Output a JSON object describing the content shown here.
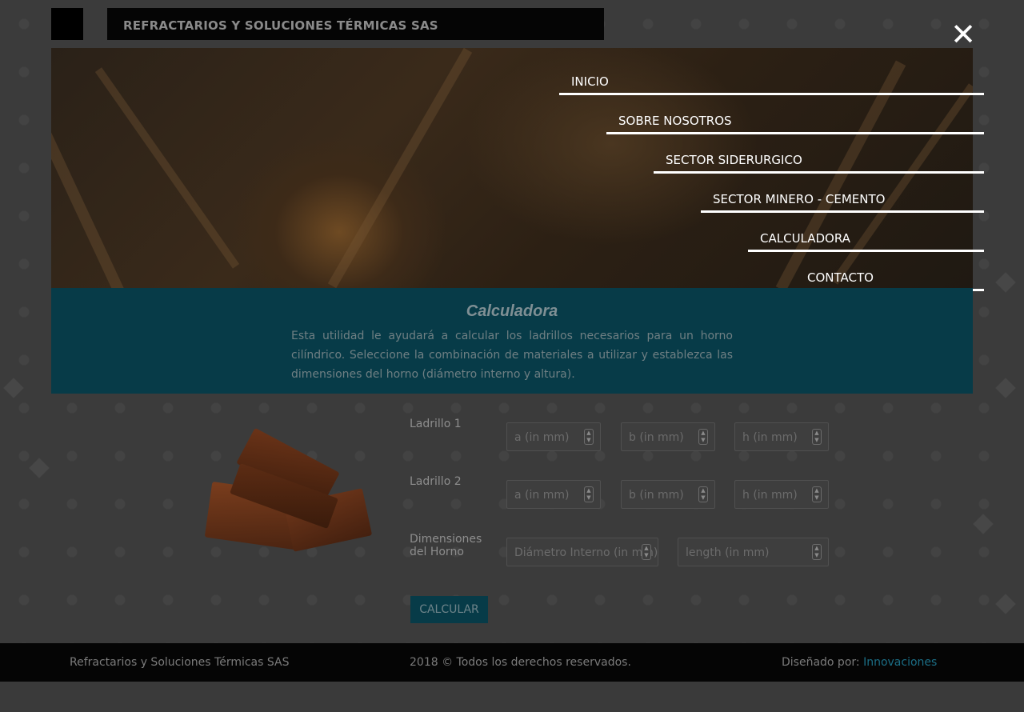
{
  "header": {
    "title": "REFRACTARIOS Y SOLUCIONES TÉRMICAS SAS",
    "close_icon": "close-icon"
  },
  "menu": {
    "items": [
      {
        "label": "INICIO"
      },
      {
        "label": "SOBRE NOSOTROS"
      },
      {
        "label": "SECTOR SIDERURGICO"
      },
      {
        "label": "SECTOR MINERO - CEMENTO"
      },
      {
        "label": "CALCULADORA"
      },
      {
        "label": "CONTACTO"
      }
    ]
  },
  "calculator": {
    "title": "Calculadora",
    "description": "Esta utilidad le ayudará a calcular los ladrillos necesarios para un horno cilíndrico. Seleccione la combinación de materiales a utilizar y establezca las dimensiones del horno (diámetro interno y altura).",
    "rows": [
      {
        "label": "Ladrillo 1",
        "placeholders": [
          "a (in mm)",
          "b (in mm)",
          "h (in mm)"
        ]
      },
      {
        "label": "Ladrillo 2",
        "placeholders": [
          "a (in mm)",
          "b (in mm)",
          "h (in mm)"
        ]
      },
      {
        "label": "Dimensiones del Horno",
        "placeholders": [
          "Diámetro Interno (in mm)",
          "length (in mm)"
        ]
      }
    ],
    "button_label": "CALCULAR"
  },
  "footer": {
    "company": "Refractarios y Soluciones Térmicas SAS",
    "copyright": "2018 © Todos los derechos reservados.",
    "designed_by_label": "Diseñado por:",
    "designed_by_link": "Innovaciones"
  },
  "colors": {
    "accent": "#073b48",
    "link": "#1b6e86"
  }
}
